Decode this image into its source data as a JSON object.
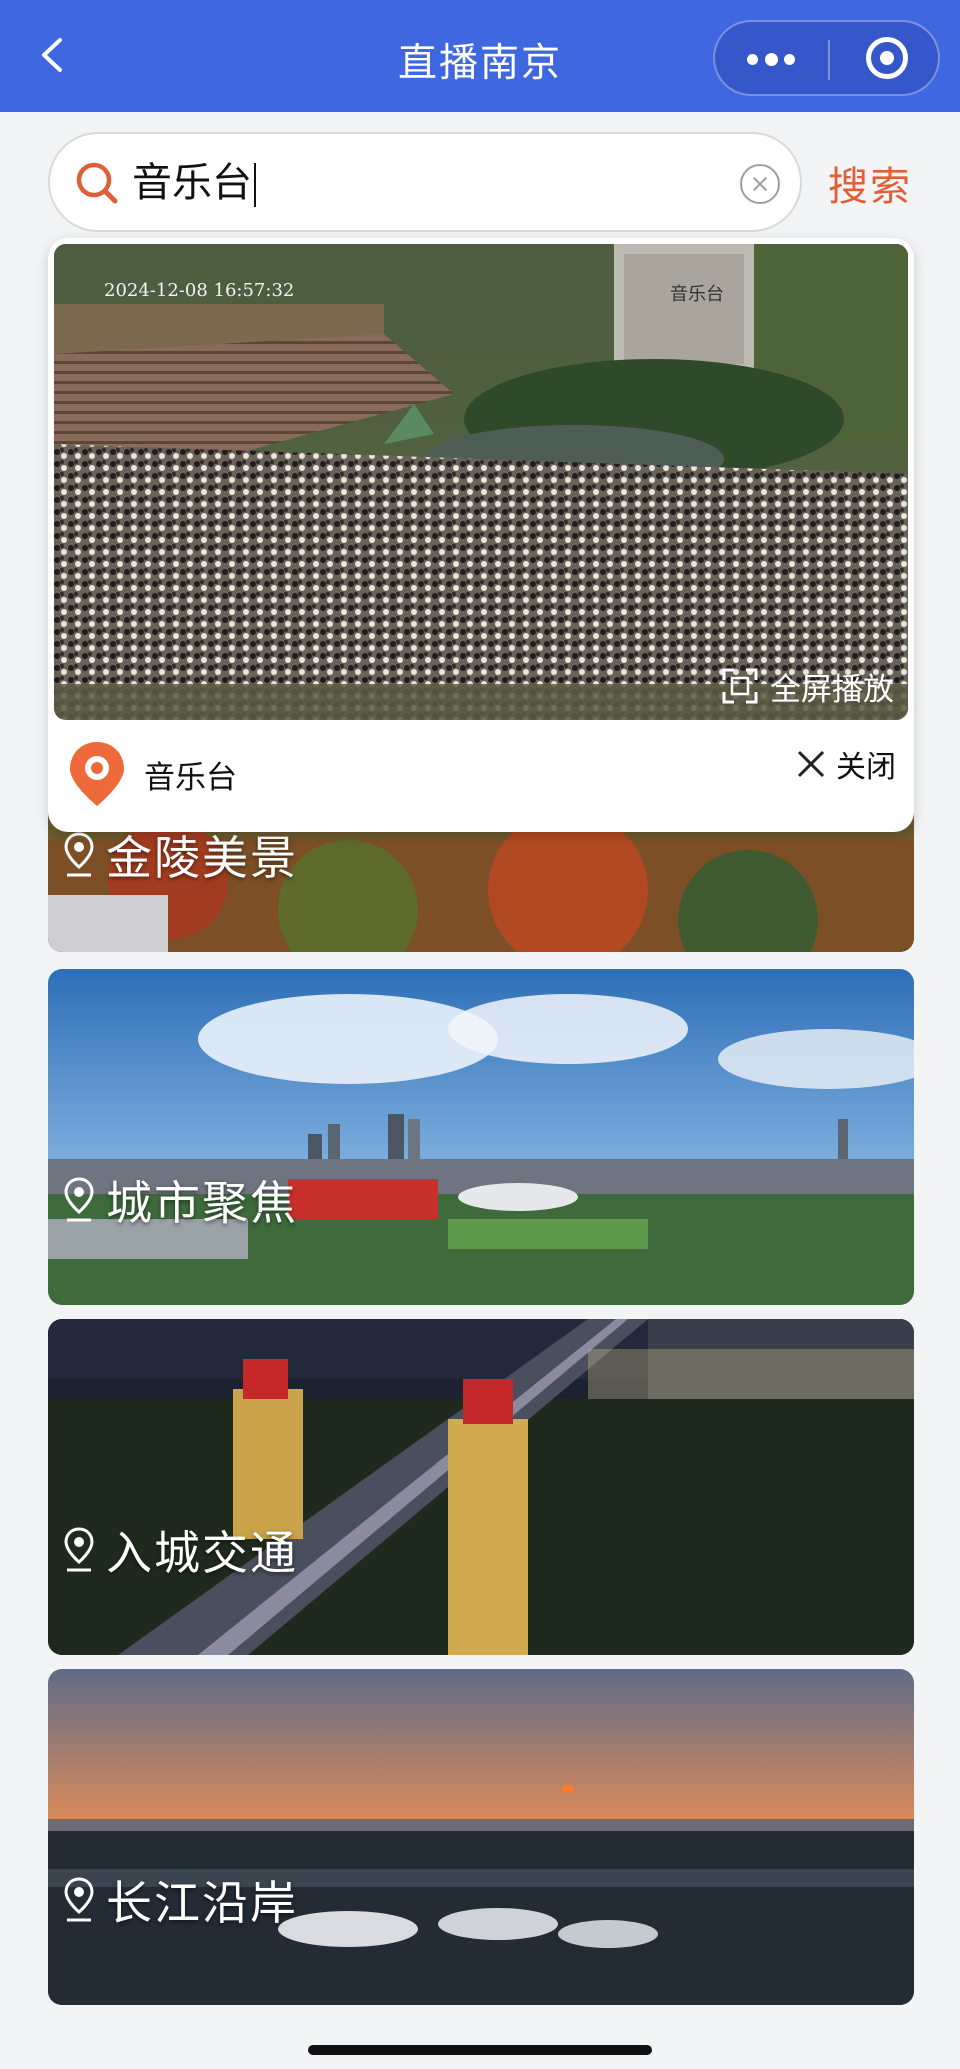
{
  "header": {
    "title": "直播南京",
    "back_icon": "chevron-left-icon",
    "more_icon": "more-dots-icon",
    "close_icon": "target-close-icon",
    "bg_color": "#3f67df"
  },
  "search": {
    "value": "音乐台",
    "placeholder": "",
    "button_label": "搜索",
    "button_color": "#e05f36",
    "icon": "search-icon",
    "clear_icon": "clear-icon"
  },
  "popup": {
    "video": {
      "timestamp": "2024-12-08 16:57:32",
      "overlay_label": "音乐台",
      "fullscreen_label": "全屏播放",
      "fullscreen_icon": "fullscreen-icon"
    },
    "place_name": "音乐台",
    "pin_icon": "location-pin-icon",
    "pin_color": "#ef6a3a",
    "close_label": "关闭",
    "close_icon": "close-icon"
  },
  "categories": [
    {
      "label": "金陵美景",
      "icon": "location-icon"
    },
    {
      "label": "城市聚焦",
      "icon": "location-icon"
    },
    {
      "label": "入城交通",
      "icon": "location-icon"
    },
    {
      "label": "长江沿岸",
      "icon": "location-icon"
    }
  ]
}
